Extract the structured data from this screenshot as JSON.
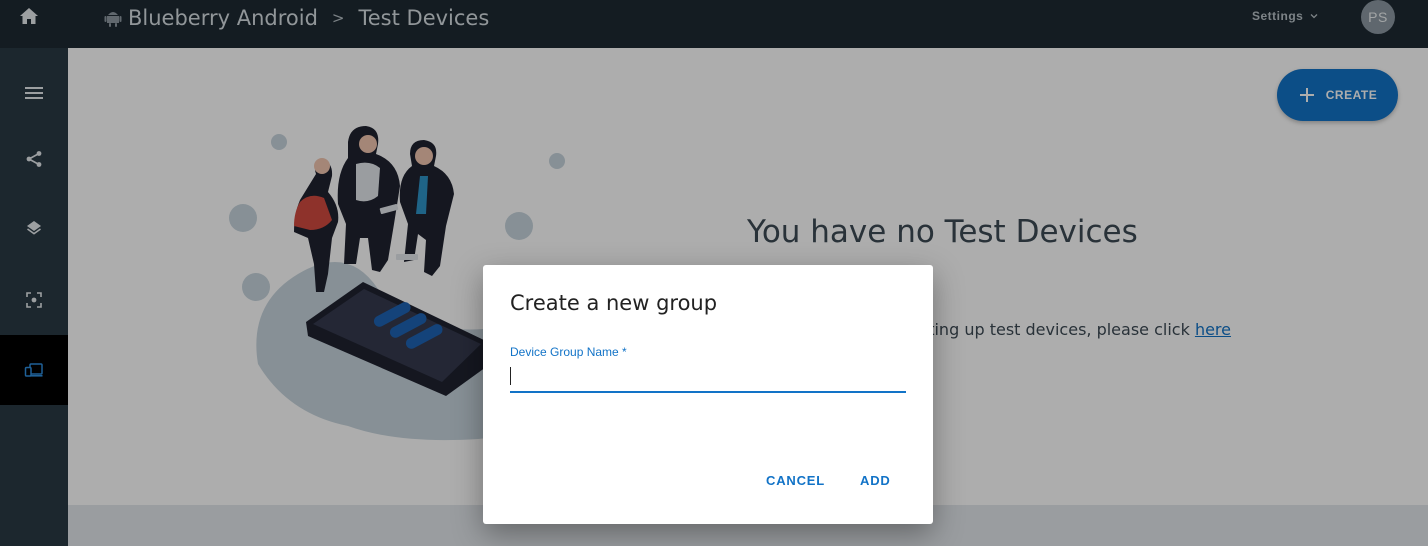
{
  "topbar": {
    "icons": {
      "home": "home-icon",
      "app": "android-icon"
    },
    "breadcrumb": [
      {
        "label": "Blueberry Android"
      },
      {
        "label": "Test Devices"
      }
    ],
    "separator": ">",
    "settings_label": "Settings",
    "avatar_initials": "PS"
  },
  "sidebar": {
    "items": [
      {
        "name": "menu",
        "icon": "hamburger-menu-icon"
      },
      {
        "name": "share",
        "icon": "share-nodes-icon"
      },
      {
        "name": "layers",
        "icon": "layers-icon"
      },
      {
        "name": "capture",
        "icon": "focus-frame-icon"
      },
      {
        "name": "devices",
        "icon": "devices-icon",
        "active": true
      }
    ]
  },
  "main": {
    "create_label": "CREATE",
    "empty_title": "You have no Test Devices",
    "empty_text": "tting up test devices, please click",
    "empty_link": "here"
  },
  "dialog": {
    "title": "Create a new group",
    "field_label": "Device Group Name *",
    "field_value": "",
    "cancel_label": "CANCEL",
    "add_label": "ADD"
  },
  "colors": {
    "topbar": "#1e2a33",
    "sidebar": "#2a3a45",
    "accent": "#1273c7",
    "overlay": "rgba(0,0,0,0.32)"
  }
}
